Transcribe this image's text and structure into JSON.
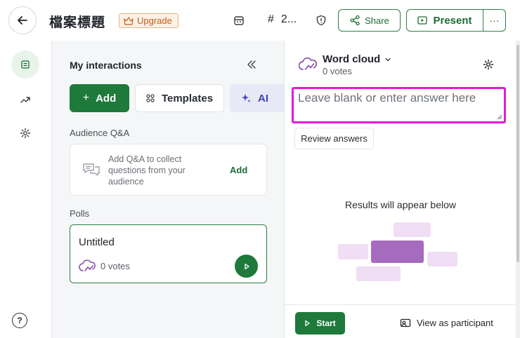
{
  "header": {
    "title": "檔案標題",
    "upgrade_label": "Upgrade",
    "code_prefix": "#",
    "code_value": "2...",
    "share_label": "Share",
    "present_label": "Present",
    "more_label": "···"
  },
  "rail": {
    "items": [
      "interactions-icon",
      "analytics-icon",
      "settings-icon"
    ],
    "help_label": "?"
  },
  "interactions": {
    "title": "My interactions",
    "add_label": "Add",
    "templates_label": "Templates",
    "ai_label": "AI",
    "qa_section_label": "Audience Q&A",
    "qa_description": "Add Q&A to collect questions from your audience",
    "qa_add_label": "Add",
    "polls_section_label": "Polls",
    "poll": {
      "title": "Untitled",
      "votes": "0 votes"
    }
  },
  "editor": {
    "type_label": "Word cloud",
    "votes": "0 votes",
    "answer_placeholder": "Leave blank or enter answer here",
    "answer_value": "",
    "review_label": "Review answers",
    "results_label": "Results will appear below",
    "start_label": "Start",
    "view_participant_label": "View as participant"
  },
  "colors": {
    "brand_green": "#1d7a3a",
    "highlight_magenta": "#e81ad4",
    "cloud_purple_dark": "#a56bbf",
    "cloud_purple_light": "#f0def5",
    "upgrade_orange": "#c45d1c"
  }
}
